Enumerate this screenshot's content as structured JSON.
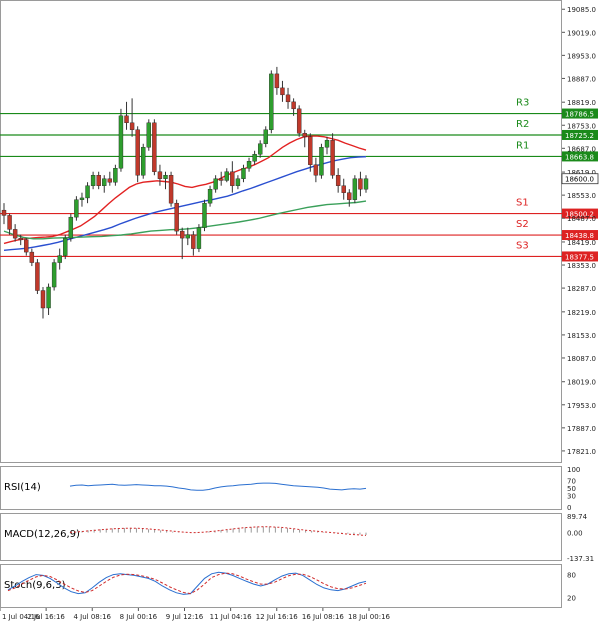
{
  "chart_data": {
    "type": "candlestick",
    "price_axis": {
      "ticks": [
        "19085.0",
        "19019.0",
        "18953.0",
        "18887.0",
        "18819.0",
        "18753.0",
        "18687.0",
        "18619.0",
        "18553.0",
        "18487.0",
        "18419.0",
        "18353.0",
        "18287.0",
        "18219.0",
        "18153.0",
        "18087.0",
        "18019.0",
        "17953.0",
        "17887.0",
        "17821.0"
      ],
      "range": [
        17795,
        19100
      ]
    },
    "time_axis": {
      "labels": [
        "1 Jul 04:16",
        "2 Jul 16:16",
        "4 Jul 08:16",
        "8 Jul 00:16",
        "9 Jul 12:16",
        "11 Jul 04:16",
        "12 Jul 16:16",
        "16 Jul 08:16",
        "18 Jul 00:16"
      ]
    },
    "levels": [
      {
        "name": "R3",
        "value": 18786.5,
        "label": "18786.5",
        "color": "#1a8a1a"
      },
      {
        "name": "R2",
        "value": 18725.2,
        "label": "18725.2",
        "color": "#1a8a1a"
      },
      {
        "name": "R1",
        "value": 18663.8,
        "label": "18663.8",
        "color": "#1a8a1a"
      },
      {
        "name": "S1",
        "value": 18500.2,
        "label": "18500.2",
        "color": "#dd2222"
      },
      {
        "name": "S2",
        "value": 18438.8,
        "label": "18438.8",
        "color": "#dd2222"
      },
      {
        "name": "S3",
        "value": 18377.5,
        "label": "18377.5",
        "color": "#dd2222"
      }
    ],
    "current_price": {
      "value": 18600.0,
      "label": "18600.0"
    },
    "candles": [
      [
        18510,
        18530,
        18470,
        18495
      ],
      [
        18495,
        18500,
        18440,
        18455
      ],
      [
        18455,
        18470,
        18420,
        18430
      ],
      [
        18430,
        18440,
        18410,
        18425
      ],
      [
        18425,
        18430,
        18380,
        18390
      ],
      [
        18390,
        18400,
        18350,
        18360
      ],
      [
        18360,
        18370,
        18270,
        18280
      ],
      [
        18280,
        18290,
        18200,
        18230
      ],
      [
        18230,
        18300,
        18210,
        18290
      ],
      [
        18290,
        18370,
        18280,
        18360
      ],
      [
        18360,
        18400,
        18340,
        18380
      ],
      [
        18380,
        18440,
        18370,
        18430
      ],
      [
        18430,
        18500,
        18420,
        18490
      ],
      [
        18490,
        18550,
        18480,
        18540
      ],
      [
        18540,
        18560,
        18520,
        18545
      ],
      [
        18545,
        18590,
        18530,
        18580
      ],
      [
        18580,
        18620,
        18570,
        18610
      ],
      [
        18610,
        18620,
        18570,
        18580
      ],
      [
        18580,
        18610,
        18560,
        18600
      ],
      [
        18600,
        18620,
        18580,
        18590
      ],
      [
        18590,
        18640,
        18580,
        18630
      ],
      [
        18630,
        18800,
        18620,
        18780
      ],
      [
        18780,
        18820,
        18740,
        18760
      ],
      [
        18760,
        18830,
        18720,
        18740
      ],
      [
        18740,
        18750,
        18590,
        18610
      ],
      [
        18610,
        18700,
        18600,
        18690
      ],
      [
        18690,
        18770,
        18680,
        18760
      ],
      [
        18760,
        18770,
        18610,
        18620
      ],
      [
        18620,
        18640,
        18580,
        18600
      ],
      [
        18600,
        18620,
        18570,
        18610
      ],
      [
        18610,
        18620,
        18520,
        18530
      ],
      [
        18530,
        18540,
        18440,
        18450
      ],
      [
        18450,
        18460,
        18370,
        18430
      ],
      [
        18430,
        18460,
        18410,
        18440
      ],
      [
        18440,
        18450,
        18380,
        18400
      ],
      [
        18400,
        18470,
        18390,
        18460
      ],
      [
        18460,
        18540,
        18450,
        18530
      ],
      [
        18530,
        18580,
        18520,
        18570
      ],
      [
        18570,
        18610,
        18560,
        18600
      ],
      [
        18600,
        18620,
        18580,
        18595
      ],
      [
        18595,
        18630,
        18590,
        18620
      ],
      [
        18620,
        18650,
        18560,
        18580
      ],
      [
        18580,
        18610,
        18570,
        18600
      ],
      [
        18600,
        18640,
        18590,
        18630
      ],
      [
        18630,
        18660,
        18620,
        18650
      ],
      [
        18650,
        18680,
        18640,
        18670
      ],
      [
        18670,
        18710,
        18660,
        18700
      ],
      [
        18700,
        18750,
        18690,
        18740
      ],
      [
        18740,
        18910,
        18730,
        18900
      ],
      [
        18900,
        18920,
        18840,
        18860
      ],
      [
        18860,
        18880,
        18820,
        18840
      ],
      [
        18840,
        18860,
        18800,
        18820
      ],
      [
        18820,
        18830,
        18780,
        18800
      ],
      [
        18800,
        18810,
        18720,
        18730
      ],
      [
        18730,
        18740,
        18690,
        18720
      ],
      [
        18720,
        18730,
        18620,
        18640
      ],
      [
        18640,
        18660,
        18590,
        18610
      ],
      [
        18610,
        18700,
        18600,
        18690
      ],
      [
        18690,
        18720,
        18670,
        18710
      ],
      [
        18710,
        18730,
        18600,
        18610
      ],
      [
        18610,
        18630,
        18560,
        18580
      ],
      [
        18580,
        18600,
        18540,
        18560
      ],
      [
        18560,
        18570,
        18520,
        18540
      ],
      [
        18540,
        18610,
        18530,
        18600
      ],
      [
        18600,
        18620,
        18550,
        18570
      ],
      [
        18570,
        18610,
        18560,
        18600
      ]
    ],
    "moving_averages": [
      {
        "color": "#e22222",
        "values": [
          18415,
          18420,
          18425,
          18428,
          18430,
          18432,
          18433,
          18435,
          18440,
          18448,
          18456,
          18465,
          18478,
          18492,
          18510,
          18528,
          18545,
          18560,
          18575,
          18585,
          18590,
          18592,
          18594,
          18592,
          18590,
          18585,
          18578,
          18575,
          18580,
          18584,
          18590,
          18600,
          18610,
          18618,
          18626,
          18632,
          18640,
          18650,
          18660,
          18675,
          18690,
          18702,
          18712,
          18719,
          18722,
          18722,
          18720,
          18715,
          18710,
          18702,
          18695,
          18688,
          18682
        ]
      },
      {
        "color": "#2a4fd0",
        "values": [
          18395,
          18397,
          18399,
          18401,
          18405,
          18409,
          18413,
          18418,
          18424,
          18430,
          18436,
          18442,
          18448,
          18454,
          18461,
          18470,
          18478,
          18486,
          18493,
          18500,
          18506,
          18511,
          18516,
          18521,
          18526,
          18531,
          18536,
          18540,
          18545,
          18550,
          18557,
          18565,
          18572,
          18580,
          18588,
          18596,
          18604,
          18612,
          18620,
          18627,
          18634,
          18640,
          18646,
          18652,
          18656,
          18660,
          18662,
          18663
        ]
      },
      {
        "color": "#3aa05a",
        "values": [
          18450,
          18440,
          18432,
          18428,
          18428,
          18430,
          18431,
          18432,
          18433,
          18434,
          18435,
          18437,
          18439,
          18442,
          18446,
          18450,
          18452,
          18454,
          18455,
          18457,
          18460,
          18464,
          18468,
          18472,
          18476,
          18481,
          18486,
          18493,
          18500,
          18506,
          18512,
          18518,
          18522,
          18526,
          18528,
          18530,
          18532,
          18536
        ]
      }
    ],
    "indicators": [
      {
        "name": "RSI(14)",
        "label": "RSI(14)",
        "axis": [
          "100",
          "70",
          "50",
          "30",
          "0"
        ],
        "range": [
          0,
          100
        ],
        "line_color": "#2a6fd0",
        "values": [
          55,
          57,
          58,
          56,
          57,
          58,
          59,
          60,
          58,
          57,
          58,
          59,
          58,
          57,
          56,
          56,
          55,
          53,
          50,
          48,
          45,
          44,
          44,
          46,
          50,
          53,
          55,
          56,
          58,
          59,
          60,
          62,
          63,
          63,
          62,
          60,
          58,
          56,
          55,
          54,
          53,
          52,
          50,
          47,
          46,
          45,
          47,
          48,
          47,
          49
        ]
      },
      {
        "name": "MACD(12,26,9)",
        "label": "MACD(12,26,9)",
        "axis": [
          "89.74",
          "0.00",
          "-137.31"
        ],
        "range": [
          -137.31,
          89.74
        ],
        "signal_color": "#d02a2a",
        "histogram": [
          2,
          5,
          9,
          12,
          16,
          18,
          20,
          22,
          24,
          25,
          26,
          24,
          22,
          18,
          15,
          12,
          9,
          5,
          2,
          -1,
          -2,
          -1,
          3,
          6,
          10,
          14,
          18,
          22,
          26,
          28,
          30,
          32,
          33,
          32,
          30,
          27,
          24,
          20,
          16,
          12,
          9,
          6,
          3,
          0,
          -2,
          -4,
          -6,
          -9,
          -11,
          -13
        ],
        "signal": [
          1,
          3,
          6,
          9,
          12,
          15,
          18,
          20,
          22,
          23,
          24,
          24,
          22,
          20,
          17,
          14,
          11,
          8,
          5,
          2,
          0,
          0,
          2,
          5,
          8,
          12,
          16,
          20,
          24,
          27,
          29,
          31,
          32,
          32,
          30,
          28,
          25,
          21,
          17,
          13,
          10,
          7,
          4,
          1,
          -2,
          -5,
          -8,
          -11,
          -13,
          -15
        ]
      },
      {
        "name": "Stoch(9,6,3)",
        "label": "Stoch(9,6,3)",
        "axis": [
          "80",
          "20"
        ],
        "range": [
          0,
          100
        ],
        "k_color": "#2a6fd0",
        "d_color": "#d02a2a",
        "k": [
          40,
          50,
          62,
          72,
          80,
          78,
          70,
          58,
          45,
          35,
          30,
          32,
          45,
          60,
          72,
          80,
          82,
          80,
          78,
          74,
          70,
          62,
          50,
          40,
          32,
          28,
          30,
          50,
          70,
          82,
          86,
          84,
          78,
          70,
          62,
          55,
          50,
          55,
          66,
          76,
          82,
          84,
          78,
          66,
          54,
          45,
          40,
          38,
          42,
          50,
          58,
          62
        ],
        "d": [
          38,
          45,
          55,
          65,
          74,
          78,
          75,
          66,
          55,
          45,
          37,
          33,
          38,
          50,
          62,
          73,
          79,
          81,
          80,
          77,
          73,
          67,
          58,
          48,
          40,
          33,
          30,
          40,
          55,
          72,
          80,
          84,
          82,
          76,
          68,
          61,
          55,
          55,
          60,
          69,
          77,
          81,
          81,
          75,
          66,
          56,
          48,
          43,
          42,
          45,
          51,
          57
        ]
      }
    ]
  }
}
